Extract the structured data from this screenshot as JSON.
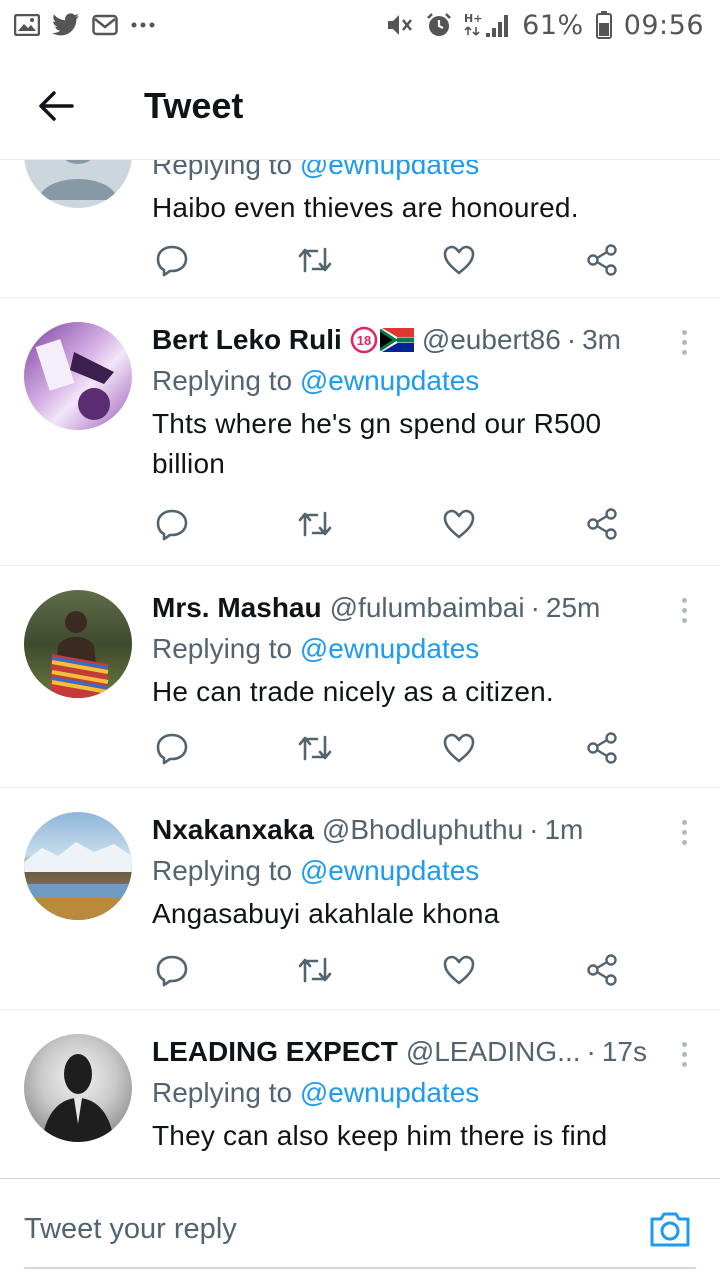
{
  "status_bar": {
    "battery": "61%",
    "time": "09:56",
    "network": "H+"
  },
  "header": {
    "title": "Tweet"
  },
  "partial_tweet": {
    "replying_label": "Replying to",
    "replying_to": "@ewnupdates",
    "text": "Haibo even thieves are honoured."
  },
  "tweets": [
    {
      "name": "Bert Leko Ruli",
      "badges": "③🇿🇦",
      "badge_18": "18",
      "handle": "@eubert86",
      "separator": "·",
      "time": "3m",
      "replying_label": "Replying to",
      "replying_to": "@ewnupdates",
      "text": "Thts where he's gn spend our R500 billion"
    },
    {
      "name": "Mrs. Mashau",
      "handle": "@fulumbaimbai",
      "separator": "·",
      "time": "25m",
      "replying_label": "Replying to",
      "replying_to": "@ewnupdates",
      "text": "He can trade nicely as a citizen."
    },
    {
      "name": "Nxakanxaka",
      "handle": "@Bhodluphuthu",
      "separator": "·",
      "time": "1m",
      "replying_label": "Replying to",
      "replying_to": "@ewnupdates",
      "text": "Angasabuyi akahlale khona"
    },
    {
      "name": "LEADING EXPECT",
      "handle": "@LEADING...",
      "separator": "·",
      "time": "17s",
      "replying_label": "Replying to",
      "replying_to": "@ewnupdates",
      "text": "They can also keep him there is find"
    }
  ],
  "reply_bar": {
    "placeholder": "Tweet your reply"
  },
  "icons": {
    "reply": "reply-icon",
    "retweet": "retweet-icon",
    "like": "like-icon",
    "share": "share-icon",
    "more": "more-vertical-icon",
    "camera": "camera-icon",
    "back": "back-arrow-icon"
  },
  "colors": {
    "accent": "#1d9bf0",
    "text": "#0f1419",
    "muted": "#536471"
  }
}
